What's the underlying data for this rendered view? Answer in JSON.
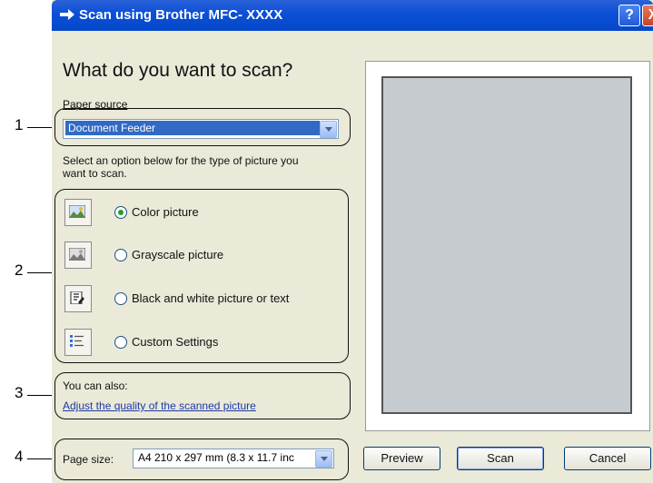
{
  "window": {
    "title": "Scan using Brother MFC- XXXX",
    "help_glyph": "?",
    "close_glyph": "X"
  },
  "heading": "What do you want to scan?",
  "paper_source": {
    "label": "Paper source",
    "value": "Document Feeder"
  },
  "instruction": {
    "line1": "Select an option below for the type of picture you",
    "line2": "want to scan."
  },
  "options": [
    {
      "label": "Color picture",
      "icon": "color-picture-icon",
      "checked": true
    },
    {
      "label": "Grayscale picture",
      "icon": "grayscale-picture-icon",
      "checked": false
    },
    {
      "label": "Black and white picture or text",
      "icon": "black-white-text-icon",
      "checked": false
    },
    {
      "label": "Custom Settings",
      "icon": "custom-settings-icon",
      "checked": false
    }
  ],
  "also": {
    "label": "You can also:",
    "link": "Adjust the quality of the scanned picture"
  },
  "page_size": {
    "label": "Page size:",
    "value": "A4 210 x 297 mm (8.3 x 11.7 inc"
  },
  "buttons": {
    "preview": "Preview",
    "scan": "Scan",
    "cancel": "Cancel"
  },
  "callouts": [
    "1",
    "2",
    "3",
    "4"
  ],
  "colors": {
    "titlebar": "#0a4fd6",
    "dialog_bg": "#ebe9d8",
    "selection": "#316ac5",
    "preview_area": "#c6cbcf"
  }
}
